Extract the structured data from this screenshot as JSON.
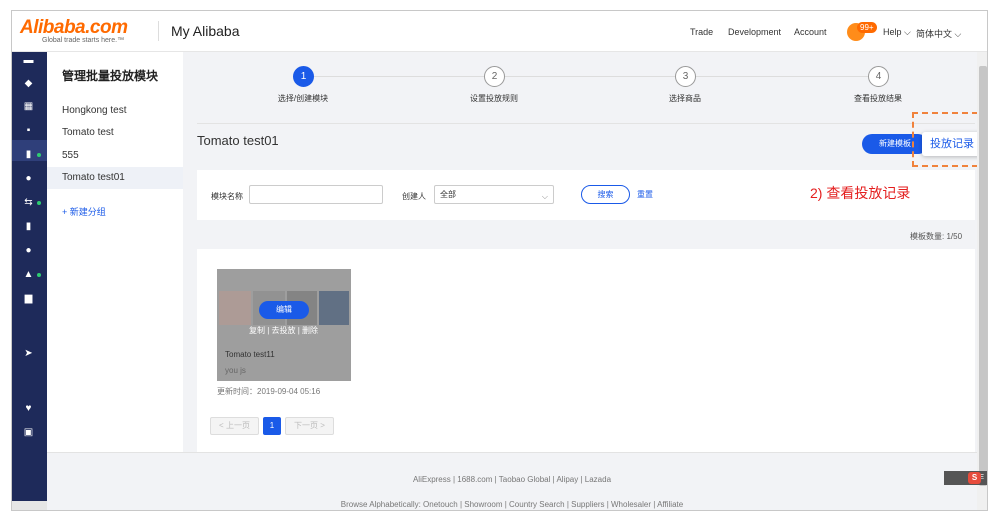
{
  "header": {
    "logo_text": "Alibaba.com",
    "logo_tagline": "Global trade starts here.™",
    "title": "My Alibaba",
    "nav": [
      "Trade",
      "Development",
      "Account"
    ],
    "badge": "99+",
    "help": "Help ⌵",
    "language": "简体中文 ⌵"
  },
  "sidebar": {
    "title": "管理批量投放模块",
    "items": [
      {
        "label": "Hongkong test",
        "active": false
      },
      {
        "label": "Tomato test",
        "active": false
      },
      {
        "label": "555",
        "active": false
      },
      {
        "label": "Tomato test01",
        "active": true
      }
    ],
    "add_group": "+ 新建分组"
  },
  "steps": [
    {
      "num": "1",
      "label": "选择/创建模块",
      "active": true
    },
    {
      "num": "2",
      "label": "设置投放规则",
      "active": false
    },
    {
      "num": "3",
      "label": "选择商品",
      "active": false
    },
    {
      "num": "4",
      "label": "查看投放结果",
      "active": false
    }
  ],
  "main": {
    "title": "Tomato test01",
    "new_button": "新建模板",
    "record_button": "投放记录",
    "annotation": "2)  查看投放记录",
    "filter": {
      "name_label": "模块名称",
      "name_value": "",
      "creator_label": "创建人",
      "creator_value": "全部",
      "search_button": "搜索",
      "reset_button": "重置"
    },
    "count": "模板数量: 1/50",
    "card": {
      "edit_button": "编辑",
      "actions": "复制 | 去投放 | 删除",
      "name": "Tomato test11",
      "owner": "you js",
      "updated": "更新时间：2019-09-04 05:16"
    },
    "pager": {
      "prev": "< 上一页",
      "current": "1",
      "next": "下一页 >"
    }
  },
  "footer": {
    "line1": "AliExpress | 1688.com | Taobao Global | Alipay | Lazada",
    "line2": "Browse Alphabetically: Onetouch | Showroom | Country Search | Suppliers | Wholesaler | Affiliate"
  },
  "widget": {
    "label": "CE",
    "s": "S"
  },
  "colors": {
    "brand": "#ff6a00",
    "accent": "#1a5ae8",
    "sidebar_dark": "#1e2a5a",
    "annotation": "#e41e1e"
  }
}
